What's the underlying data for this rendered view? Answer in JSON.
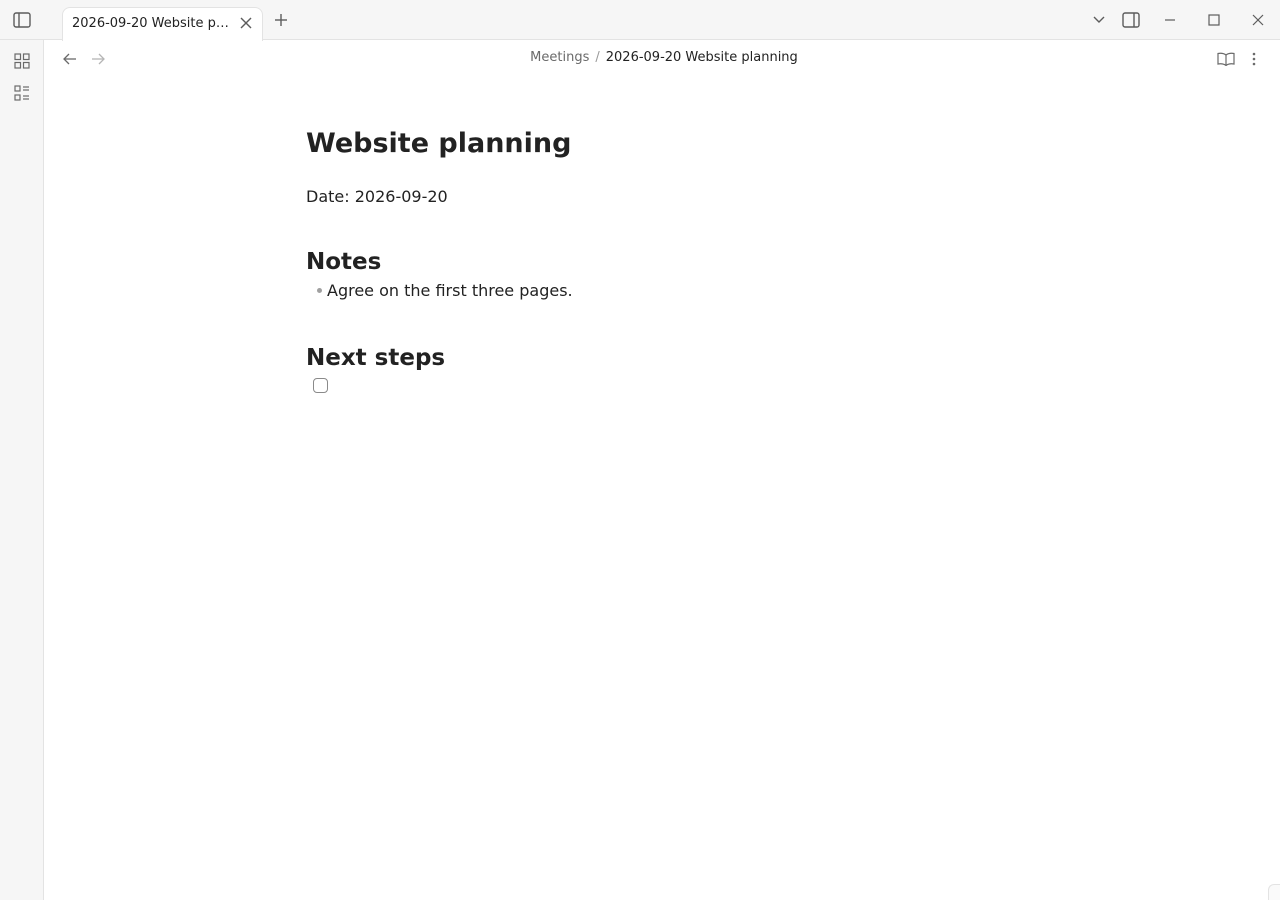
{
  "window": {
    "tab_title": "2026-09-20 Website plan...",
    "icons": {
      "sidebar_toggle": "sidebar-toggle-icon",
      "tab_close": "close-icon",
      "new_tab": "plus-icon",
      "tab_list": "chevron-down-icon",
      "right_sidebar": "right-sidebar-icon",
      "minimize": "minimize-icon",
      "maximize": "maximize-icon",
      "close": "close-icon"
    }
  },
  "ribbon": {
    "items": [
      {
        "icon": "dashboard-icon"
      },
      {
        "icon": "list-icon"
      }
    ]
  },
  "header": {
    "breadcrumb": {
      "parent": "Meetings",
      "separator": "/",
      "current": "2026-09-20 Website planning"
    },
    "icons": {
      "back": "arrow-left-icon",
      "forward": "arrow-right-icon",
      "reading_view": "book-open-icon",
      "more": "more-vertical-icon"
    }
  },
  "note": {
    "title": "Website planning",
    "date_line": "Date: 2026-09-20",
    "sections": [
      {
        "heading": "Notes",
        "items": [
          "Agree on the first three pages."
        ]
      },
      {
        "heading": "Next steps",
        "tasks": [
          {
            "text": "",
            "checked": false
          }
        ]
      }
    ]
  }
}
